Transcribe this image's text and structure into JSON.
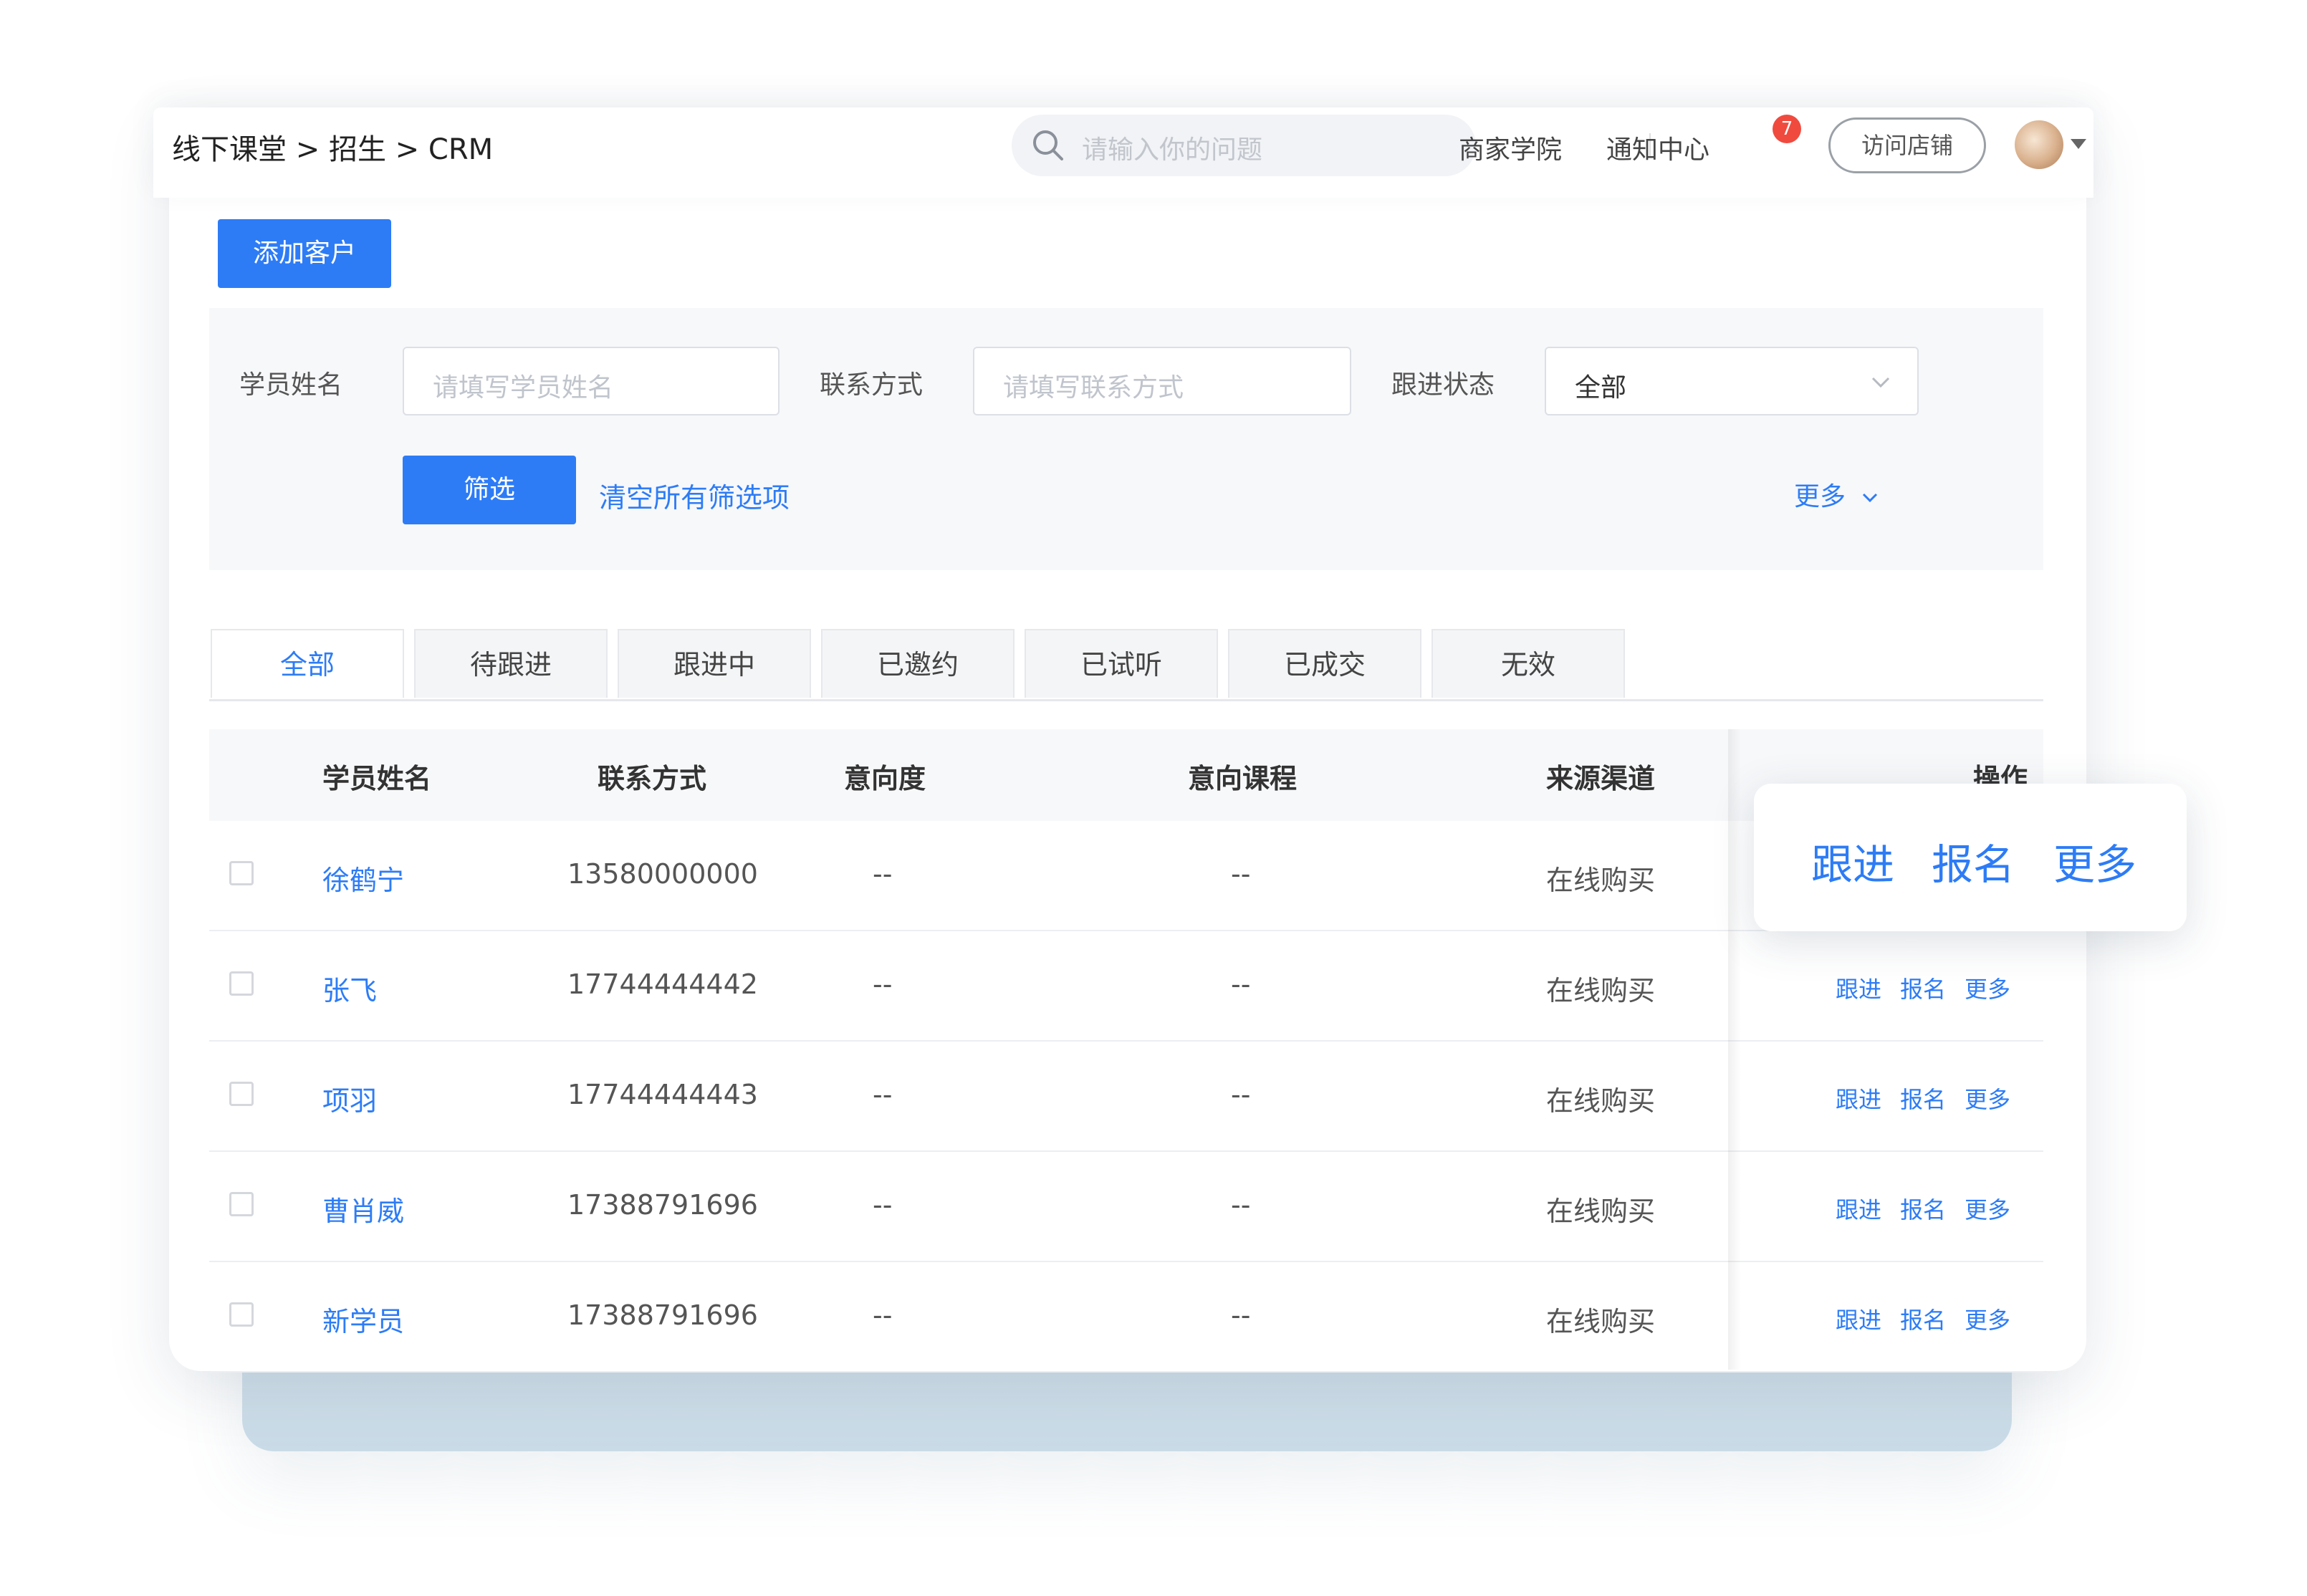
{
  "header": {
    "breadcrumb": "线下课堂 > 招生 > CRM",
    "search_placeholder": "请输入你的问题",
    "merchant_academy": "商家学院",
    "notification_center": "通知中心",
    "notification_count": "7",
    "visit_store": "访问店铺"
  },
  "toolbar": {
    "add_customer": "添加客户"
  },
  "filters": {
    "student_name_label": "学员姓名",
    "student_name_placeholder": "请填写学员姓名",
    "contact_label": "联系方式",
    "contact_placeholder": "请填写联系方式",
    "status_label": "跟进状态",
    "status_value": "全部",
    "screen_button": "筛选",
    "clear_all": "清空所有筛选项",
    "more": "更多"
  },
  "tabs": [
    "全部",
    "待跟进",
    "跟进中",
    "已邀约",
    "已试听",
    "已成交",
    "无效"
  ],
  "table": {
    "headers": {
      "name": "学员姓名",
      "contact": "联系方式",
      "intent": "意向度",
      "course": "意向课程",
      "source": "来源渠道",
      "actions": "操作"
    },
    "rows": [
      {
        "name": "徐鹤宁",
        "contact": "13580000000",
        "intent": "--",
        "course": "--",
        "source": "在线购买"
      },
      {
        "name": "张飞",
        "contact": "17744444442",
        "intent": "--",
        "course": "--",
        "source": "在线购买"
      },
      {
        "name": "项羽",
        "contact": "17744444443",
        "intent": "--",
        "course": "--",
        "source": "在线购买"
      },
      {
        "name": "曹肖威",
        "contact": "17388791696",
        "intent": "--",
        "course": "--",
        "source": "在线购买"
      },
      {
        "name": "新学员",
        "contact": "17388791696",
        "intent": "--",
        "course": "--",
        "source": "在线购买"
      }
    ],
    "row_actions": {
      "follow": "跟进",
      "enroll": "报名",
      "more": "更多"
    }
  },
  "popover": {
    "follow": "跟进",
    "enroll": "报名",
    "more": "更多"
  },
  "colors": {
    "accent": "#2d7cf6",
    "badge": "#f04a3e"
  }
}
